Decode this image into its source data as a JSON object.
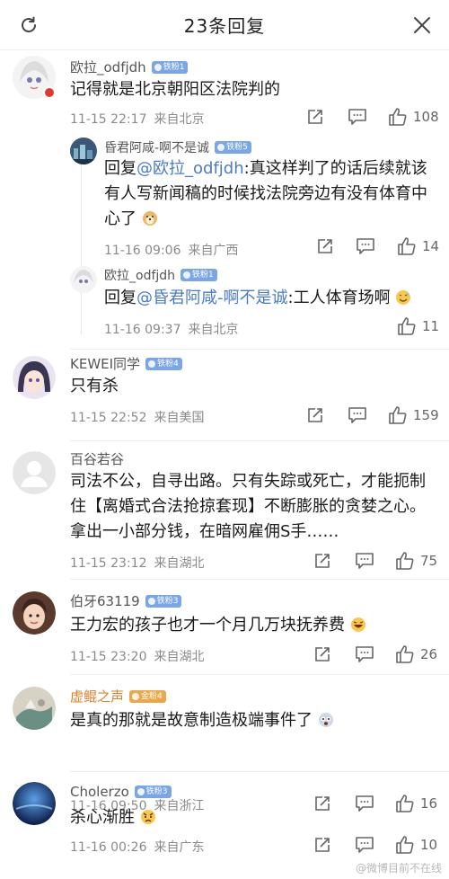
{
  "header": {
    "title": "23条回复",
    "refresh_icon": "refresh-icon",
    "close_icon": "close-icon"
  },
  "comments": [
    {
      "user": "欧拉_odfjdh",
      "badge": "铁粉1",
      "text": "记得就是北京朝阳区法院判的",
      "time": "11-15 22:17",
      "location": "来自北京",
      "likes": "108",
      "replies": [
        {
          "user": "昏君阿咸-啊不是诚",
          "badge": "铁粉5",
          "prefix": "回复",
          "mention": "@欧拉_odfjdh",
          "text": ":真这样判了的话后续就该有人写新闻稿的时候找法院旁边有没有体育中心了",
          "emoji": "dog-face",
          "time": "11-16 09:06",
          "location": "来自广西",
          "likes": "14"
        },
        {
          "user": "欧拉_odfjdh",
          "badge": "铁粉1",
          "prefix": "回复",
          "mention": "@昏君阿咸-啊不是诚",
          "text": ":工人体育场啊",
          "emoji": "sweat-smile",
          "time": "11-16 09:37",
          "location": "来自北京",
          "likes": "11"
        }
      ]
    },
    {
      "user": "KEWEI同学",
      "badge": "铁粉4",
      "text": "只有杀",
      "time": "11-15 22:52",
      "location": "来自美国",
      "likes": "159"
    },
    {
      "user": "百谷若谷",
      "badge": "",
      "text": "司法不公，自寻出路。只有失踪或死亡，才能扼制住【离婚式合法抢掠套现】不断膨胀的贪婪之心。拿出一小部分钱，在暗网雇佣S手……",
      "time": "11-15 23:12",
      "location": "来自湖北",
      "likes": "75"
    },
    {
      "user": "伯牙63119",
      "badge": "铁粉3",
      "text": "王力宏的孩子也才一个月几万块抚养费",
      "emoji": "laughing",
      "time": "11-15 23:20",
      "location": "来自湖北",
      "likes": "26"
    },
    {
      "user": "虚鲲之声",
      "badge": "金粉4",
      "text": "是真的那就是故意制造极端事件了",
      "emoji": "scared",
      "time": "11-16 09:50",
      "location": "来自浙江",
      "likes": "16"
    },
    {
      "user": "Cholerzo",
      "badge": "铁粉3",
      "text": "杀心渐胜",
      "emoji": "angry-face",
      "time": "11-16 00:26",
      "location": "来自广东",
      "likes": "10"
    }
  ],
  "watermark": "@微博目前不在线",
  "colors": {
    "mention": "#4a7bc6",
    "badge_iron": "#7aa6e6",
    "badge_gold": "#e9a94a"
  }
}
